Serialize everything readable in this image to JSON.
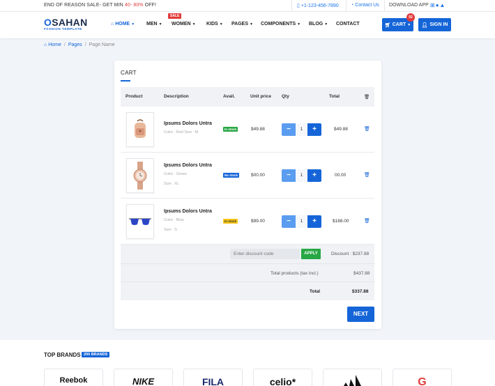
{
  "topbar": {
    "promo_prefix": "END OF REASON SALE- GET MIN ",
    "promo_highlight": "40- 80%",
    "promo_suffix": " OFF!",
    "phone": "+1-123-456-7890",
    "contact": "Contact Us",
    "download": "DOWNLOAD APP",
    "os_icons": "⊞  ⌘"
  },
  "navbar": {
    "logo_main": "SAHAN",
    "logo_o": "O",
    "logo_sub": "FASHION TEMPLATE",
    "items": [
      {
        "label": "HOME"
      },
      {
        "label": "MEN"
      },
      {
        "label": "WOMEN"
      },
      {
        "label": "KIDS"
      },
      {
        "label": "PAGES"
      },
      {
        "label": "COMPONENTS"
      },
      {
        "label": "BLOG"
      },
      {
        "label": "CONTACT"
      }
    ],
    "sale_badge": "SALE",
    "cart_label": "CART",
    "cart_count": "02",
    "signin_label": "SIGN IN"
  },
  "breadcrumb": {
    "home": "Home",
    "pages": "Pages",
    "current": "Page Name"
  },
  "cart": {
    "title": "CART",
    "columns": {
      "product": "Product",
      "description": "Description",
      "avail": "Avail.",
      "unit_price": "Unit price",
      "qty": "Qty",
      "total": "Total"
    },
    "items": [
      {
        "name": "Ipsums Dolors Untra",
        "meta1": "Color : Red Size : M",
        "meta2": "",
        "avail": "In stock",
        "unit_price": "$49.88",
        "qty": "1",
        "total": "$49.88"
      },
      {
        "name": "Ipsums Dolors Untra",
        "meta1": "Color : Green",
        "meta2": "Size : XL",
        "avail": "No stock",
        "unit_price": "$00.00",
        "qty": "1",
        "total": "00.00"
      },
      {
        "name": "Ipsums Dolors Untra",
        "meta1": "Color : Blue",
        "meta2": "Size : S",
        "avail": "In stock",
        "unit_price": "$99.00",
        "qty": "1",
        "total": "$188.00"
      }
    ],
    "discount_placeholder": "Enter discount code",
    "apply_label": "APPLY",
    "discount_text": "Discount : $237.88",
    "total_products_label": "Total products (tax incl.)",
    "total_products_value": "$437.88",
    "total_label": "Total",
    "total_value": "$337.88",
    "next_label": "NEXT"
  },
  "brands": {
    "title": "TOP BRANDS",
    "badge": "200 BRANDS",
    "items": [
      {
        "name": "Reebok",
        "color": "#111111"
      },
      {
        "name": "NIKE",
        "color": "#111111"
      },
      {
        "name": "FILA",
        "color": "#1a2a6c"
      },
      {
        "name": "celio*",
        "color": "#111111"
      },
      {
        "name": "adidas",
        "color": "#111111"
      },
      {
        "name": "G",
        "color": "#e23b3b"
      }
    ]
  },
  "colors": {
    "primary": "#1565d8",
    "sale_red": "#e23b3b",
    "success": "#28a745",
    "warning": "#f5c518"
  }
}
